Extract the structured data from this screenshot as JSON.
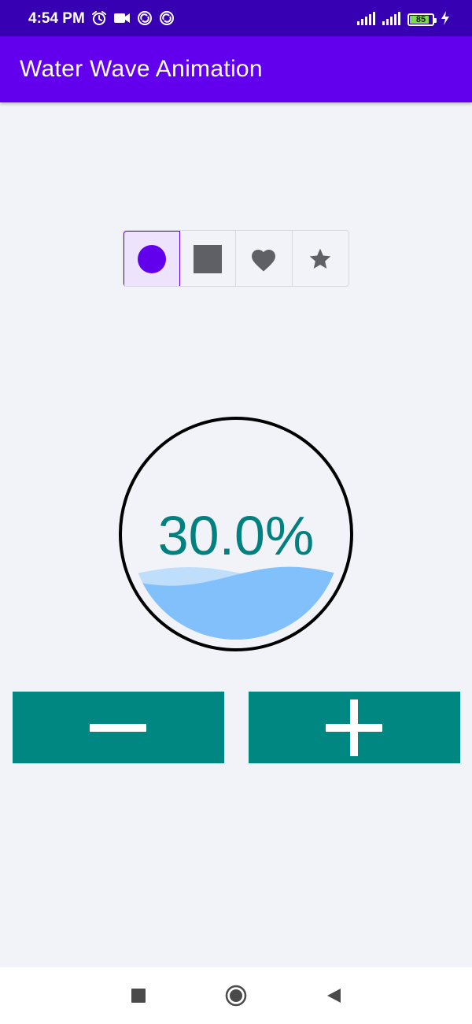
{
  "status_bar": {
    "time": "4:54 PM",
    "left_icons": [
      "alarm-icon",
      "video-camera-icon",
      "sync-icon",
      "sync-icon"
    ],
    "right_icons": [
      "signal-icon",
      "signal-icon",
      "battery-icon",
      "charging-icon"
    ],
    "battery_level": "85",
    "bg_color": "#3700b3"
  },
  "app_bar": {
    "title": "Water Wave Animation",
    "bg_color": "#6200ee"
  },
  "shape_selector": {
    "options": [
      {
        "name": "circle",
        "icon": "circle-icon",
        "selected": true
      },
      {
        "name": "square",
        "icon": "square-icon",
        "selected": false
      },
      {
        "name": "heart",
        "icon": "heart-icon",
        "selected": false
      },
      {
        "name": "star",
        "icon": "star-icon",
        "selected": false
      }
    ],
    "selected_color": "#6200ee",
    "icon_color": "#5f6066"
  },
  "wave_gauge": {
    "shape": "circle",
    "progress": 0.3,
    "percent_label": "30.0%",
    "wave_color": "#82c0fb",
    "text_color": "#00807f",
    "border_color": "#000000"
  },
  "controls": {
    "decrease_icon": "minus-icon",
    "increase_icon": "plus-icon",
    "button_color": "#008782"
  },
  "nav_bar": {
    "buttons": [
      "recents-icon",
      "home-icon",
      "back-icon"
    ]
  }
}
